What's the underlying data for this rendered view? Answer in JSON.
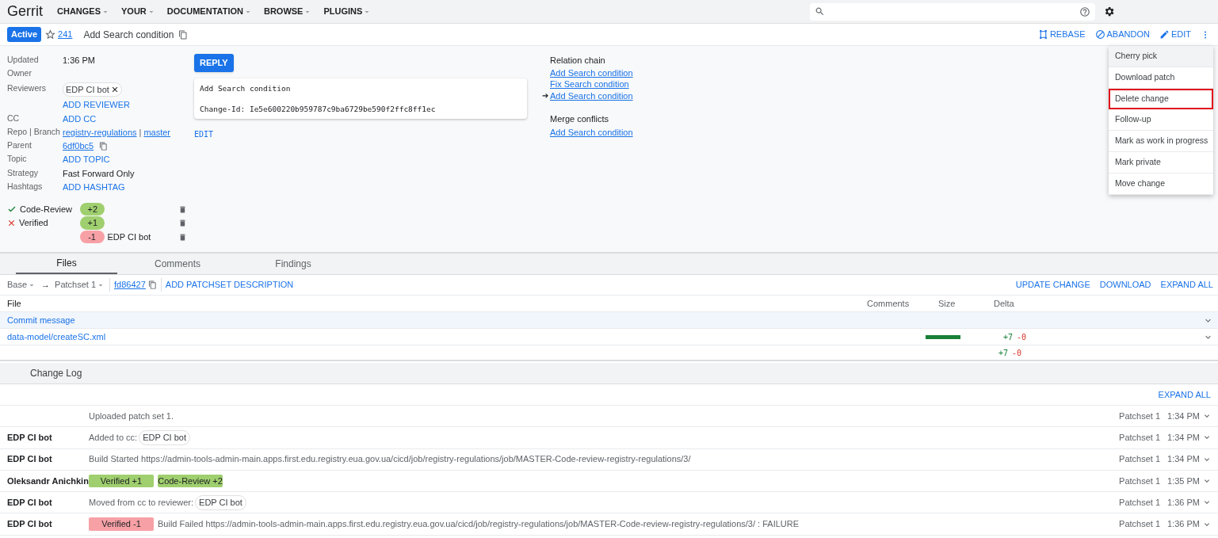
{
  "header": {
    "logo": "Gerrit",
    "menus": [
      {
        "label": "CHANGES"
      },
      {
        "label": "YOUR"
      },
      {
        "label": "DOCUMENTATION"
      },
      {
        "label": "BROWSE"
      },
      {
        "label": "PLUGINS"
      }
    ]
  },
  "change": {
    "status": "Active",
    "starred": false,
    "number": "241",
    "subject": "Add Search condition",
    "actions": [
      {
        "kind": "rebase",
        "label": "REBASE"
      },
      {
        "kind": "abandon",
        "label": "ABANDON"
      },
      {
        "kind": "edit",
        "label": "EDIT"
      }
    ]
  },
  "overflow_menu": [
    {
      "label": "Cherry pick",
      "hovered": true,
      "highlighted": false
    },
    {
      "label": "Download patch",
      "hovered": false,
      "highlighted": false
    },
    {
      "label": "Delete change",
      "hovered": false,
      "highlighted": true
    },
    {
      "label": "Follow-up",
      "hovered": false,
      "highlighted": false
    },
    {
      "label": "Mark as work in progress",
      "hovered": false,
      "highlighted": false
    },
    {
      "label": "Mark private",
      "hovered": false,
      "highlighted": false
    },
    {
      "label": "Move change",
      "hovered": false,
      "highlighted": false
    }
  ],
  "metadata": [
    {
      "label": "Updated",
      "kind": "text",
      "values": [
        "1:36 PM"
      ]
    },
    {
      "label": "Owner",
      "kind": "blank"
    },
    {
      "label": "Reviewers",
      "kind": "chips",
      "values": [
        "EDP CI bot"
      ],
      "action": "ADD REVIEWER"
    },
    {
      "label": "CC",
      "kind": "action",
      "values": [
        "ADD CC"
      ]
    },
    {
      "label": "Repo | Branch",
      "kind": "links",
      "values": [
        "registry-regulations",
        "master"
      ],
      "separator": "|"
    },
    {
      "label": "Parent",
      "kind": "commit",
      "values": [
        "6df0bc5"
      ]
    },
    {
      "label": "Topic",
      "kind": "action",
      "values": [
        "ADD TOPIC"
      ]
    },
    {
      "label": "Strategy",
      "kind": "text",
      "values": [
        "Fast Forward Only"
      ]
    },
    {
      "label": "Hashtags",
      "kind": "action",
      "values": [
        "ADD HASHTAG"
      ]
    }
  ],
  "labels": [
    {
      "name": "Code-Review",
      "approved": true,
      "votes": [
        {
          "value": "+2",
          "positive": true
        }
      ]
    },
    {
      "name": "Verified",
      "approved": false,
      "votes": [
        {
          "value": "+1",
          "positive": true
        },
        {
          "value": "-1",
          "positive": false,
          "account": "EDP CI bot"
        }
      ]
    }
  ],
  "reply_button": "REPLY",
  "commit_message": {
    "subject": "Add Search condition",
    "change_id": "Change-Id: Ie5e600220b959787c9ba6729be590f2ffc8ff1ec",
    "edit": "EDIT"
  },
  "relation_chain": {
    "title": "Relation chain",
    "current_marker": "➔",
    "items": [
      {
        "label": "Add Search condition",
        "current": false
      },
      {
        "label": "Fix Search condition",
        "current": false
      },
      {
        "label": "Add Search condition",
        "current": true
      }
    ]
  },
  "merge_conflicts": {
    "title": "Merge conflicts",
    "items": [
      "Add Search condition"
    ]
  },
  "tabs": [
    {
      "label": "Files",
      "selected": true
    },
    {
      "label": "Comments",
      "selected": false
    },
    {
      "label": "Findings",
      "selected": false
    }
  ],
  "patchset_bar": {
    "base": "Base",
    "arrow": "→",
    "patchset": "Patchset 1",
    "commit": "fd86427",
    "add_description": "ADD PATCHSET DESCRIPTION",
    "actions": [
      "UPDATE CHANGE",
      "DOWNLOAD",
      "EXPAND ALL"
    ]
  },
  "files_table": {
    "columns": [
      "File",
      "Comments",
      "Size",
      "Delta"
    ],
    "rows": [
      {
        "file": "Commit message"
      },
      {
        "file": "data-model/createSC.xml",
        "level": 1,
        "added": "+7",
        "removed": "-0"
      }
    ],
    "total": {
      "added": "+7",
      "removed": "-0"
    }
  },
  "change_log": {
    "title": "Change Log",
    "expand_all": "EXPAND ALL",
    "entries": [
      {
        "parts": [
          {
            "kind": "text",
            "text": "Uploaded patch set 1."
          }
        ],
        "patchset": "Patchset 1",
        "time": "1:34 PM"
      },
      {
        "author": "EDP CI bot",
        "parts": [
          {
            "kind": "text",
            "text": "Added to cc:"
          },
          {
            "kind": "account",
            "text": "EDP CI bot"
          }
        ],
        "patchset": "Patchset 1",
        "time": "1:34 PM"
      },
      {
        "author": "EDP CI bot",
        "parts": [
          {
            "kind": "text",
            "text": "Build Started https://admin-tools-admin-main.apps.first.edu.registry.eua.gov.ua/cicd/job/registry-regulations/job/MASTER-Code-review-registry-regulations/3/"
          }
        ],
        "patchset": "Patchset 1",
        "time": "1:34 PM"
      },
      {
        "author": "Oleksandr Anichkin",
        "parts": [
          {
            "kind": "vote_positive",
            "text": "Verified +1"
          },
          {
            "kind": "vote_positive",
            "text": "Code-Review +2"
          }
        ],
        "patchset": "Patchset 1",
        "time": "1:35 PM"
      },
      {
        "author": "EDP CI bot",
        "parts": [
          {
            "kind": "text",
            "text": "Moved from cc to reviewer:"
          },
          {
            "kind": "account",
            "text": "EDP CI bot"
          }
        ],
        "patchset": "Patchset 1",
        "time": "1:36 PM"
      },
      {
        "author": "EDP CI bot",
        "parts": [
          {
            "kind": "vote_negative",
            "text": "Verified -1"
          },
          {
            "kind": "text",
            "text": "Build Failed https://admin-tools-admin-main.apps.first.edu.registry.eua.gov.ua/cicd/job/registry-regulations/job/MASTER-Code-review-registry-regulations/3/ : FAILURE"
          }
        ],
        "patchset": "Patchset 1",
        "time": "1:36 PM"
      }
    ]
  }
}
